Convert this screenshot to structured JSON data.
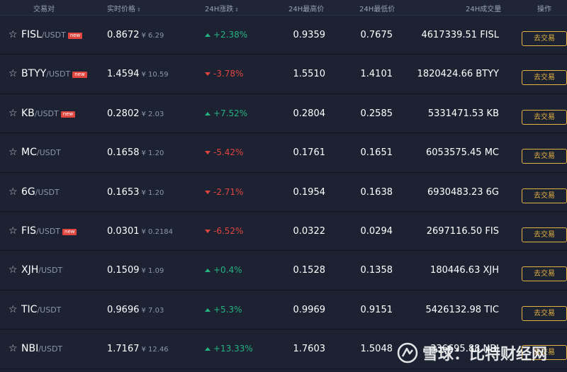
{
  "columns": {
    "pair": "交易对",
    "price": "实时价格",
    "change": "24H涨跌",
    "high": "24H最高价",
    "low": "24H最低价",
    "volume": "24H成交量",
    "action": "操作"
  },
  "sort_glyph": "⇕",
  "new_badge": "new",
  "trade_label": "去交易",
  "colors": {
    "up": "#25b280",
    "down": "#e0453f",
    "accent": "#e3b341",
    "background": "#1b2132"
  },
  "rows": [
    {
      "base": "FISL",
      "quote": "/USDT",
      "is_new": true,
      "price": "0.8672",
      "cny": "¥ 6.29",
      "change": "+2.38%",
      "direction": "up",
      "high": "0.9359",
      "low": "0.7675",
      "volume": "4617339.51 FISL"
    },
    {
      "base": "BTYY",
      "quote": "/USDT",
      "is_new": true,
      "price": "1.4594",
      "cny": "¥ 10.59",
      "change": "-3.78%",
      "direction": "down",
      "high": "1.5510",
      "low": "1.4101",
      "volume": "1820424.66 BTYY"
    },
    {
      "base": "KB",
      "quote": "/USDT",
      "is_new": true,
      "price": "0.2802",
      "cny": "¥ 2.03",
      "change": "+7.52%",
      "direction": "up",
      "high": "0.2804",
      "low": "0.2585",
      "volume": "5331471.53 KB"
    },
    {
      "base": "MC",
      "quote": "/USDT",
      "is_new": false,
      "price": "0.1658",
      "cny": "¥ 1.20",
      "change": "-5.42%",
      "direction": "down",
      "high": "0.1761",
      "low": "0.1651",
      "volume": "6053575.45 MC"
    },
    {
      "base": "6G",
      "quote": "/USDT",
      "is_new": false,
      "price": "0.1653",
      "cny": "¥ 1.20",
      "change": "-2.71%",
      "direction": "down",
      "high": "0.1954",
      "low": "0.1638",
      "volume": "6930483.23 6G"
    },
    {
      "base": "FIS",
      "quote": "/USDT",
      "is_new": true,
      "price": "0.0301",
      "cny": "¥ 0.2184",
      "change": "-6.52%",
      "direction": "down",
      "high": "0.0322",
      "low": "0.0294",
      "volume": "2697116.50 FIS"
    },
    {
      "base": "XJH",
      "quote": "/USDT",
      "is_new": false,
      "price": "0.1509",
      "cny": "¥ 1.09",
      "change": "+0.4%",
      "direction": "up",
      "high": "0.1528",
      "low": "0.1358",
      "volume": "180446.63 XJH"
    },
    {
      "base": "TIC",
      "quote": "/USDT",
      "is_new": false,
      "price": "0.9696",
      "cny": "¥ 7.03",
      "change": "+5.3%",
      "direction": "up",
      "high": "0.9969",
      "low": "0.9151",
      "volume": "5426132.98 TIC"
    },
    {
      "base": "NBI",
      "quote": "/USDT",
      "is_new": false,
      "price": "1.7167",
      "cny": "¥ 12.46",
      "change": "+13.33%",
      "direction": "up",
      "high": "1.7603",
      "low": "1.5048",
      "volume": "336695.88 NBI"
    }
  ],
  "watermark": {
    "text": "雪球：比特财经网"
  }
}
